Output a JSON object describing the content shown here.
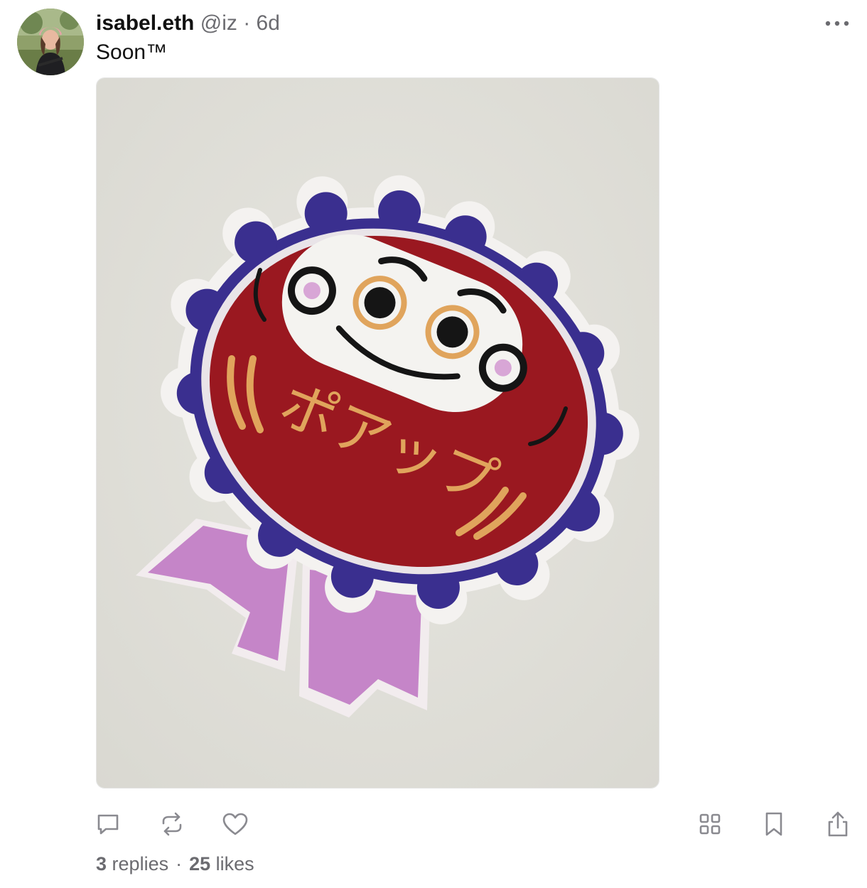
{
  "post": {
    "author": {
      "name": "isabel.eth",
      "handle": "@iz"
    },
    "separator": "·",
    "time": "6d",
    "text": "Soon™",
    "image": {
      "embroidered_text": "ポアップ"
    }
  },
  "stats": {
    "replies_count": "3",
    "replies_label": "replies",
    "separator": "·",
    "likes_count": "25",
    "likes_label": "likes"
  },
  "icons": {
    "more": "more-horizontal-icon",
    "reply": "comment-icon",
    "recast": "recast-icon",
    "like": "heart-icon",
    "grid": "grid-icon",
    "bookmark": "bookmark-icon",
    "share": "share-icon"
  },
  "colors": {
    "text": "#111111",
    "muted": "#6b6b70",
    "icon": "#8a8a90"
  }
}
